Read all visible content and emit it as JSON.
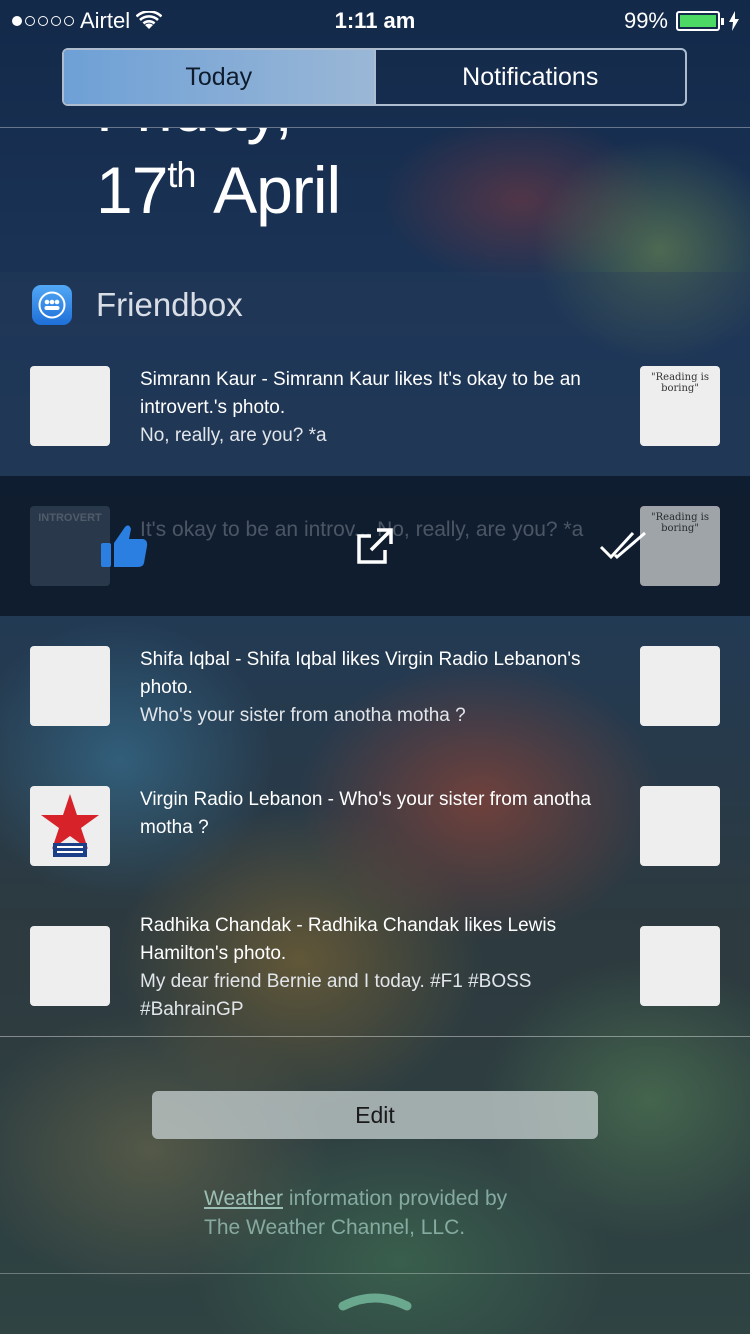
{
  "status_bar": {
    "carrier": "Airtel",
    "time": "1:11 am",
    "battery": "99%",
    "battery_level": 0.99
  },
  "tabs": [
    {
      "label": "Today",
      "active": true
    },
    {
      "label": "Notifications",
      "active": false
    }
  ],
  "date": {
    "weekday": "Friday,",
    "day": "17",
    "suffix": "th",
    "month": "April"
  },
  "widget": {
    "title": "Friendbox",
    "icon": "friendbox-icon"
  },
  "notifications": [
    {
      "title": "Simrann Kaur - Simrann Kaur likes It's okay to be an introvert.'s photo.",
      "message": "No, really, are you? *a",
      "thumb_text": "\"Reading is boring\""
    },
    {
      "title": "Shifa Iqbal - Shifa Iqbal likes Virgin Radio Lebanon's photo.",
      "message": "Who's your sister from anotha motha ?"
    },
    {
      "title": "Virgin Radio Lebanon - Who's your sister from anotha motha ?",
      "message": ""
    },
    {
      "title": "Radhika Chandak - Radhika Chandak likes Lewis Hamilton's photo.",
      "message": "My dear friend Bernie and I today. #F1 #BOSS #BahrainGP"
    }
  ],
  "action_row": {
    "ghost_text": "It's okay to be an introv... No, really, are you? *a",
    "avatar_text": "INTROVERT",
    "thumb_text": "\"Reading is boring\"",
    "actions": [
      "like-icon",
      "open-external-icon",
      "mark-read-icon"
    ],
    "like_color": "#2a7fe0"
  },
  "edit_label": "Edit",
  "weather": {
    "link": "Weather",
    "line1_rest": " information provided by",
    "line2": "The Weather Channel, LLC."
  }
}
